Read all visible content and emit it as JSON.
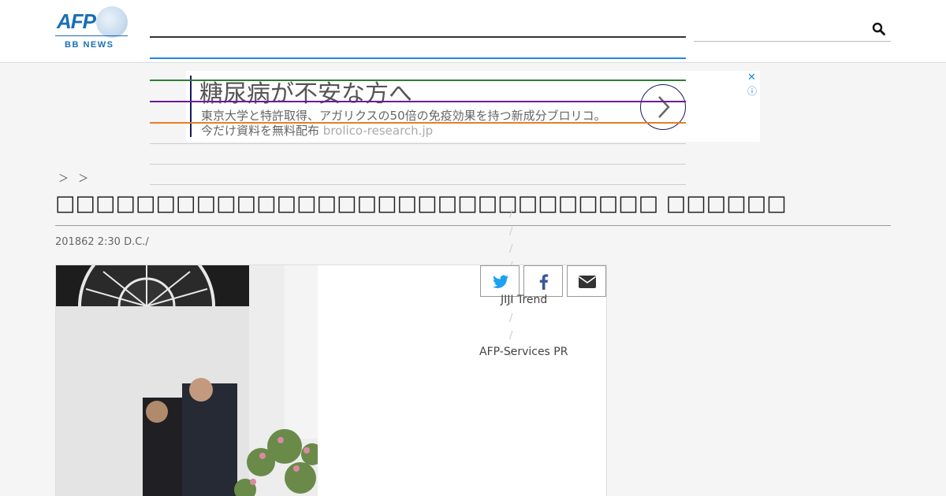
{
  "header": {
    "logo_text": "AFP",
    "logo_sub": "BB NEWS",
    "search_placeholder": ""
  },
  "ad": {
    "title": "糖尿病が不安な方へ",
    "description": "東京大学と特許取得、アガリクスの50倍の免疫効果を持つ新成分ブロリコ。",
    "footer": "今だけ資料を無料配布",
    "domain": "brolico-research.jp",
    "close_glyph": "✕",
    "info_glyph": "ⓘ"
  },
  "article": {
    "breadcrumb": "＞ ＞",
    "title": "□□□□□□□□□□□□□□□□□□□□□□□□□□□□□□ □□□□□□",
    "dateline": "201862 2:30  D.C./"
  },
  "share": {
    "twitter_icon": "twitter-icon",
    "facebook_icon": "facebook-icon",
    "mail_icon": "mail-icon"
  },
  "sidebar": {
    "link1": "JIJI Trend",
    "link2": "AFP-Services PR"
  },
  "colors": {
    "brand": "#1a6fb5",
    "ad_accent": "#1a1a5e",
    "line_blue": "#1e88e5",
    "line_green": "#2e7d32",
    "line_purple": "#6a1b9a",
    "line_orange": "#e67e22"
  }
}
